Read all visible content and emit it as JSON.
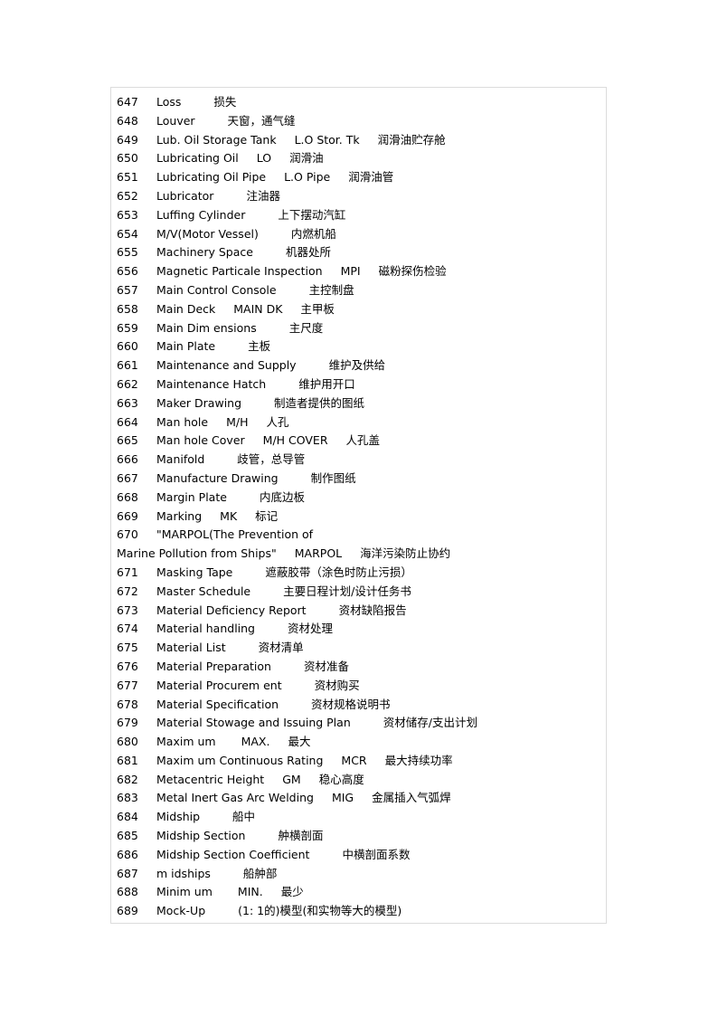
{
  "entries": [
    {
      "num": "647",
      "term": "Loss",
      "abbr": "",
      "cn": "损失",
      "gap1": 36,
      "gap2": 0
    },
    {
      "num": "648",
      "term": "Louver",
      "abbr": "",
      "cn": "天窗，通气缝",
      "gap1": 36,
      "gap2": 0
    },
    {
      "num": "649",
      "term": "Lub. Oil Storage Tank",
      "abbr": "L.O Stor. Tk",
      "cn": "润滑油贮存舱",
      "gap1": 20,
      "gap2": 20
    },
    {
      "num": "650",
      "term": "Lubricating Oil",
      "abbr": "LO",
      "cn": "润滑油",
      "gap1": 20,
      "gap2": 20
    },
    {
      "num": "651",
      "term": "Lubricating Oil Pipe",
      "abbr": "L.O Pipe",
      "cn": "润滑油管",
      "gap1": 20,
      "gap2": 20
    },
    {
      "num": "652",
      "term": "Lubricator",
      "abbr": "",
      "cn": "注油器",
      "gap1": 36,
      "gap2": 0
    },
    {
      "num": "653",
      "term": "Luffing Cylinder",
      "abbr": "",
      "cn": "上下摆动汽缸",
      "gap1": 36,
      "gap2": 0
    },
    {
      "num": "654",
      "term": "M/V(Motor Vessel)",
      "abbr": "",
      "cn": "内燃机船",
      "gap1": 36,
      "gap2": 0
    },
    {
      "num": "655",
      "term": "Machinery Space",
      "abbr": "",
      "cn": "机器处所",
      "gap1": 36,
      "gap2": 0
    },
    {
      "num": "656",
      "term": "Magnetic Particale Inspection",
      "abbr": "MPI",
      "cn": "磁粉探伤检验",
      "gap1": 20,
      "gap2": 20
    },
    {
      "num": "657",
      "term": "Main Control Console",
      "abbr": "",
      "cn": "主控制盘",
      "gap1": 36,
      "gap2": 0
    },
    {
      "num": "658",
      "term": "Main Deck",
      "abbr": "MAIN DK",
      "cn": "主甲板",
      "gap1": 20,
      "gap2": 20
    },
    {
      "num": "659",
      "term": "Main Dim ensions",
      "abbr": "",
      "cn": "主尺度",
      "gap1": 36,
      "gap2": 0
    },
    {
      "num": "660",
      "term": "Main Plate",
      "abbr": "",
      "cn": "主板",
      "gap1": 36,
      "gap2": 0
    },
    {
      "num": "661",
      "term": "Maintenance and Supply",
      "abbr": "",
      "cn": "维护及供给",
      "gap1": 36,
      "gap2": 0
    },
    {
      "num": "662",
      "term": "Maintenance Hatch",
      "abbr": "",
      "cn": "维护用开口",
      "gap1": 36,
      "gap2": 0
    },
    {
      "num": "663",
      "term": "Maker Drawing",
      "abbr": "",
      "cn": "制造者提供的图纸",
      "gap1": 36,
      "gap2": 0
    },
    {
      "num": "664",
      "term": "Man hole",
      "abbr": "M/H",
      "cn": "人孔",
      "gap1": 20,
      "gap2": 20
    },
    {
      "num": "665",
      "term": "Man hole Cover",
      "abbr": "M/H COVER",
      "cn": "人孔盖",
      "gap1": 20,
      "gap2": 20
    },
    {
      "num": "666",
      "term": "Manifold",
      "abbr": "",
      "cn": "歧管，总导管",
      "gap1": 36,
      "gap2": 0
    },
    {
      "num": "667",
      "term": "Manufacture Drawing",
      "abbr": "",
      "cn": "制作图纸",
      "gap1": 36,
      "gap2": 0
    },
    {
      "num": "668",
      "term": "Margin Plate",
      "abbr": "",
      "cn": "内底边板",
      "gap1": 36,
      "gap2": 0
    },
    {
      "num": "669",
      "term": "Marking",
      "abbr": "MK",
      "cn": "标记",
      "gap1": 20,
      "gap2": 20
    },
    {
      "num": "670",
      "term": "\"MARPOL(The Prevention of",
      "abbr": "",
      "cn": "",
      "gap1": 0,
      "gap2": 0
    },
    {
      "num": "",
      "term": "Marine Pollution from  Ships\"",
      "abbr": "MARPOL",
      "cn": "海洋污染防止协约",
      "gap1": 20,
      "gap2": 20,
      "continuation": true
    },
    {
      "num": "671",
      "term": "Masking Tape",
      "abbr": "",
      "cn": "遮蔽胶带（涂色时防止污损）",
      "gap1": 36,
      "gap2": 0
    },
    {
      "num": "672",
      "term": "Master Schedule",
      "abbr": "",
      "cn": "主要日程计划/设计任务书",
      "gap1": 36,
      "gap2": 0
    },
    {
      "num": "673",
      "term": "Material Deficiency Report",
      "abbr": "",
      "cn": "资材缺陷报告",
      "gap1": 36,
      "gap2": 0
    },
    {
      "num": "674",
      "term": "Material handling",
      "abbr": "",
      "cn": "资材处理",
      "gap1": 36,
      "gap2": 0
    },
    {
      "num": "675",
      "term": "Material List",
      "abbr": "",
      "cn": "资材清单",
      "gap1": 36,
      "gap2": 0
    },
    {
      "num": "676",
      "term": "Material Preparation",
      "abbr": "",
      "cn": "资材准备",
      "gap1": 36,
      "gap2": 0
    },
    {
      "num": "677",
      "term": "Material Procurem ent",
      "abbr": "",
      "cn": "资材购买",
      "gap1": 36,
      "gap2": 0
    },
    {
      "num": "678",
      "term": "Material Specification",
      "abbr": "",
      "cn": "资材规格说明书",
      "gap1": 36,
      "gap2": 0
    },
    {
      "num": "679",
      "term": "Material Stowage and Issuing Plan",
      "abbr": "",
      "cn": "资材储存/支出计划",
      "gap1": 36,
      "gap2": 0
    },
    {
      "num": "680",
      "term": "Maxim um",
      "abbr": "MAX.",
      "cn": "最大",
      "gap1": 28,
      "gap2": 20
    },
    {
      "num": "681",
      "term": "Maxim um  Continuous Rating",
      "abbr": "MCR",
      "cn": "最大持续功率",
      "gap1": 20,
      "gap2": 20
    },
    {
      "num": "682",
      "term": "Metacentric Height",
      "abbr": "GM",
      "cn": "稳心高度",
      "gap1": 20,
      "gap2": 20
    },
    {
      "num": "683",
      "term": "Metal Inert Gas Arc Welding",
      "abbr": "MIG",
      "cn": "金属插入气弧焊",
      "gap1": 20,
      "gap2": 20
    },
    {
      "num": "684",
      "term": "Midship",
      "abbr": "",
      "cn": "船中",
      "gap1": 36,
      "gap2": 0
    },
    {
      "num": "685",
      "term": "Midship Section",
      "abbr": "",
      "cn": "舯横剖面",
      "gap1": 36,
      "gap2": 0
    },
    {
      "num": "686",
      "term": "Midship Section Coefficient",
      "abbr": "",
      "cn": "中横剖面系数",
      "gap1": 36,
      "gap2": 0
    },
    {
      "num": "687",
      "term": "m idships",
      "abbr": "",
      "cn": "船舯部",
      "gap1": 36,
      "gap2": 0
    },
    {
      "num": "688",
      "term": "Minim um",
      "abbr": "MIN.",
      "cn": "最少",
      "gap1": 28,
      "gap2": 20
    },
    {
      "num": "689",
      "term": "Mock-Up",
      "abbr": "",
      "cn": "(1: 1的)模型(和实物等大的模型)",
      "gap1": 36,
      "gap2": 0
    }
  ]
}
